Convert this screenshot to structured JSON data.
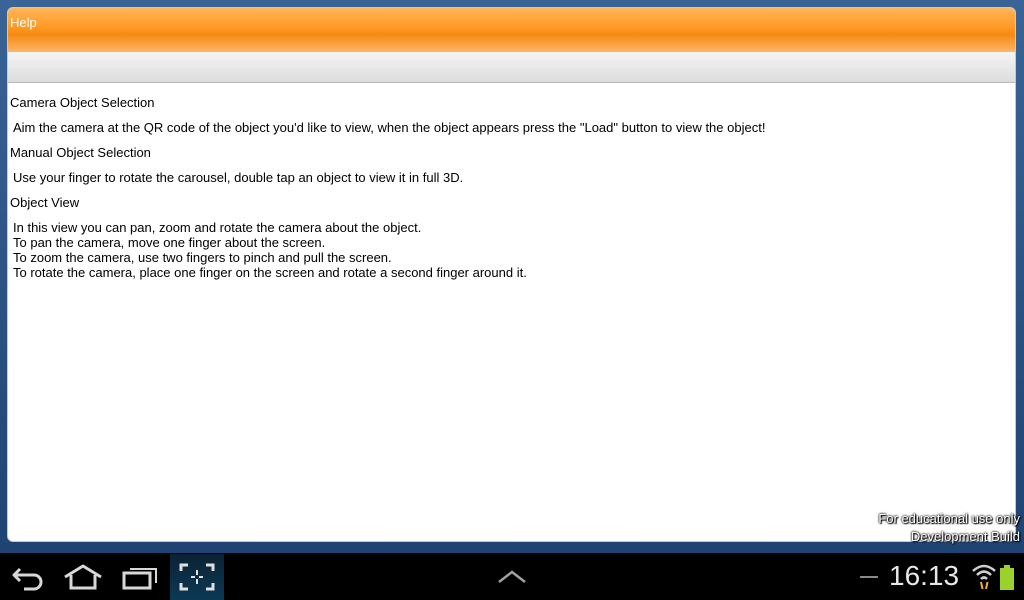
{
  "window": {
    "title": "Help"
  },
  "help": {
    "sections": [
      {
        "heading": "Camera Object Selection",
        "lines": [
          "Aim the camera at the QR code of the object you'd like to view, when the object appears press the \"Load\" button to view the object!"
        ]
      },
      {
        "heading": "Manual Object Selection",
        "lines": [
          "Use your finger to rotate the carousel, double tap an object to view it in full 3D."
        ]
      },
      {
        "heading": "Object View",
        "lines": [
          "In this view you can pan, zoom and rotate the camera about the object.",
          "To pan the camera, move one finger about the screen.",
          "To zoom the camera, use two fingers to pinch and pull the screen.",
          "To rotate the camera, place one finger on the screen and rotate a second finger around it."
        ]
      }
    ]
  },
  "watermark": {
    "line1": "For educational use only",
    "line2": "Development Build"
  },
  "system_bar": {
    "time": "16:13",
    "icons": [
      "back-icon",
      "home-icon",
      "recent-apps-icon",
      "screenshot-icon",
      "chevron-up-icon",
      "wifi-icon",
      "battery-icon"
    ],
    "accent_color": "#ff9922",
    "battery_color": "#9ad12a"
  }
}
